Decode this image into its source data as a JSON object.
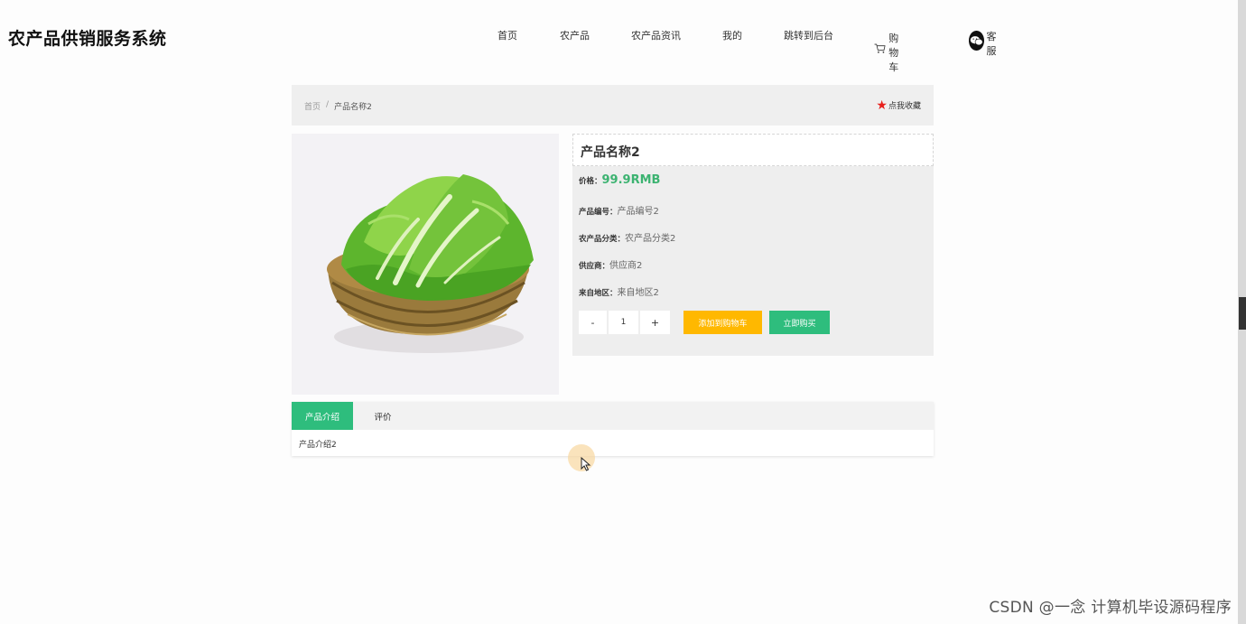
{
  "header": {
    "site_title": "农产品供销服务系统",
    "nav": {
      "home": "首页",
      "products": "农产品",
      "news": "农产品资讯",
      "mine": "我的",
      "admin": "跳转到后台",
      "cart": "购物车",
      "service": "客服"
    }
  },
  "breadcrumb": {
    "home": "首页",
    "separator": "/",
    "current": "产品名称2"
  },
  "favorite": {
    "label": "点我收藏"
  },
  "product": {
    "name": "产品名称2",
    "price_label": "价格：",
    "price": "99.9RMB",
    "code_label": "产品编号：",
    "code": "产品编号2",
    "category_label": "农产品分类：",
    "category": "农产品分类2",
    "supplier_label": "供应商：",
    "supplier": "供应商2",
    "origin_label": "来自地区：",
    "origin": "来自地区2"
  },
  "quantity": {
    "minus": "-",
    "value": "1",
    "plus": "+"
  },
  "buttons": {
    "add_to_cart": "添加到购物车",
    "buy_now": "立即购买"
  },
  "tabs": {
    "intro": "产品介绍",
    "reviews": "评价",
    "content": "产品介绍2"
  },
  "watermark": "CSDN @一念 计算机毕设源码程序",
  "colors": {
    "accent_green": "#2ebd7d",
    "price_green": "#3cb371",
    "cart_yellow": "#ffb800",
    "star_red": "#e8201c"
  }
}
